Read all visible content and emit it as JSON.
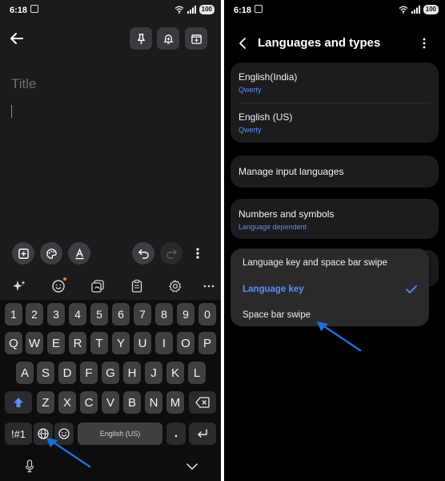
{
  "left_screen": {
    "status_bar": {
      "time": "6:18",
      "battery": "100"
    },
    "note": {
      "title_placeholder": "Title"
    },
    "keyboard": {
      "number_row": [
        "1",
        "2",
        "3",
        "4",
        "5",
        "6",
        "7",
        "8",
        "9",
        "0"
      ],
      "row_1": [
        "Q",
        "W",
        "E",
        "R",
        "T",
        "Y",
        "U",
        "I",
        "O",
        "P"
      ],
      "row_2": [
        "A",
        "S",
        "D",
        "F",
        "G",
        "H",
        "J",
        "K",
        "L"
      ],
      "row_3": [
        "Z",
        "X",
        "C",
        "V",
        "B",
        "N",
        "M"
      ],
      "symbols_key": "!#1",
      "space_label": "English (US)",
      "period_key": "."
    },
    "icons": {
      "back": "back-arrow-icon",
      "pin": "pin-icon",
      "reminder": "bell-add-icon",
      "add_to": "box-add-icon",
      "insert": "plus-square-icon",
      "palette": "palette-icon",
      "text_style": "text-format-icon",
      "undo": "undo-icon",
      "redo": "redo-icon",
      "more": "more-vert-icon",
      "ai": "sparkle-icon",
      "emoji": "emoji-icon",
      "sticker": "sticker-icon",
      "clipboard": "clipboard-icon",
      "settings": "gear-icon",
      "overflow": "more-horiz-icon",
      "shift": "shift-icon",
      "backspace": "backspace-icon",
      "globe": "globe-icon",
      "enter": "enter-icon",
      "mic": "mic-icon",
      "hide_keyboard": "chevron-down-icon"
    }
  },
  "right_screen": {
    "status_bar": {
      "time": "6:18",
      "battery": "100"
    },
    "header": {
      "title": "Languages and types"
    },
    "languages": [
      {
        "name": "English(India)",
        "type": "Qwerty"
      },
      {
        "name": "English (US)",
        "type": "Qwerty"
      }
    ],
    "manage_languages": "Manage input languages",
    "numbers_symbols": {
      "label": "Numbers and symbols",
      "sub": "Language dependent"
    },
    "popup": {
      "options": [
        "Language key and space bar swipe",
        "Language key",
        "Space bar swipe"
      ],
      "selected": "Language key"
    }
  },
  "colors": {
    "accent_blue": "#5a8ff0",
    "arrow_blue": "#1e6fd9",
    "key_bg": "#3f3f42"
  }
}
